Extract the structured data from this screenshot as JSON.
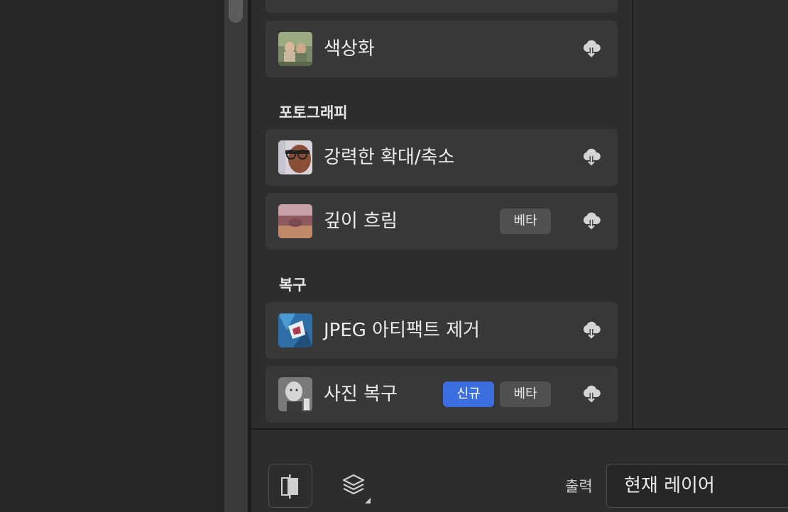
{
  "sections": [
    {
      "title": "포토그래피"
    },
    {
      "title": "복구"
    }
  ],
  "cards": [
    {
      "label": "색상화",
      "badges": []
    },
    {
      "label": "강력한 확대/축소",
      "badges": []
    },
    {
      "label": "깊이 흐림",
      "badges": [
        "베타"
      ]
    },
    {
      "label": "JPEG 아티팩트 제거",
      "badges": []
    },
    {
      "label": "사진 복구",
      "badges": [
        "신규",
        "베타"
      ]
    }
  ],
  "badges": {
    "beta": "베타",
    "new": "신규"
  },
  "bottom": {
    "output_label": "출력",
    "output_value": "현재 레이어"
  },
  "icons": {
    "download": "cloud-download-icon",
    "compare": "compare-split-icon",
    "layers": "layers-icon"
  },
  "colors": {
    "accent_new": "#3b6fe0",
    "badge_beta": "#505050",
    "card_bg": "#383838",
    "panel_bg": "#2d2d2d"
  }
}
